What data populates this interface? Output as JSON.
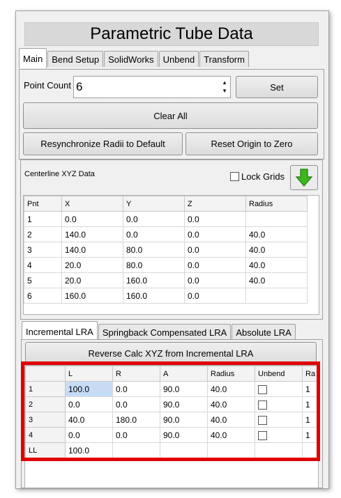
{
  "header": {
    "title": "Parametric Tube Data"
  },
  "main_tabs": [
    {
      "label": "Main",
      "active": true
    },
    {
      "label": "Bend Setup",
      "active": false
    },
    {
      "label": "SolidWorks",
      "active": false
    },
    {
      "label": "Unbend",
      "active": false
    },
    {
      "label": "Transform",
      "active": false
    }
  ],
  "point_count": {
    "label": "Point Count",
    "value": "6"
  },
  "buttons": {
    "set": "Set",
    "clear_all": "Clear All",
    "resync": "Resynchronize Radii to Default",
    "reset_origin": "Reset Origin to Zero",
    "reverse_calc": "Reverse Calc XYZ from Incremental LRA"
  },
  "centerline": {
    "title": "Centerline XYZ Data",
    "lock_grids": "Lock Grids",
    "columns": [
      "Pnt",
      "X",
      "Y",
      "Z",
      "Radius"
    ],
    "rows": [
      [
        "1",
        "0.0",
        "0.0",
        "0.0",
        ""
      ],
      [
        "2",
        "140.0",
        "0.0",
        "0.0",
        "40.0"
      ],
      [
        "3",
        "140.0",
        "80.0",
        "0.0",
        "40.0"
      ],
      [
        "4",
        "20.0",
        "80.0",
        "0.0",
        "40.0"
      ],
      [
        "5",
        "20.0",
        "160.0",
        "0.0",
        "40.0"
      ],
      [
        "6",
        "160.0",
        "160.0",
        "0.0",
        ""
      ]
    ]
  },
  "lra_tabs": [
    {
      "label": "Incremental LRA",
      "active": true
    },
    {
      "label": "Springback Compensated LRA",
      "active": false
    },
    {
      "label": "Absolute LRA",
      "active": false
    }
  ],
  "lra": {
    "columns": [
      "",
      "L",
      "R",
      "A",
      "Radius",
      "Unbend",
      "Ra"
    ],
    "rows": [
      {
        "id": "1",
        "L": "100.0",
        "R": "0.0",
        "A": "90.0",
        "Radius": "40.0",
        "extra": "1"
      },
      {
        "id": "2",
        "L": "0.0",
        "R": "0.0",
        "A": "90.0",
        "Radius": "40.0",
        "extra": "1"
      },
      {
        "id": "3",
        "L": "40.0",
        "R": "180.0",
        "A": "90.0",
        "Radius": "40.0",
        "extra": "1"
      },
      {
        "id": "4",
        "L": "0.0",
        "R": "0.0",
        "A": "90.0",
        "Radius": "40.0",
        "extra": "1"
      }
    ],
    "last_row": {
      "id": "LL",
      "L": "100.0"
    }
  },
  "colors": {
    "highlight": "#e00000",
    "arrow": "#3cb81c",
    "selected_cell": "#c6dcf5"
  }
}
